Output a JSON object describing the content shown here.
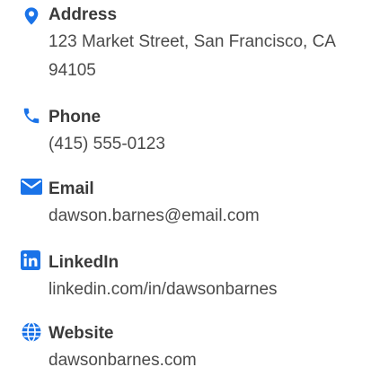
{
  "accent_color": "#1a73e8",
  "contact": {
    "items": [
      {
        "icon": "map-pin-icon",
        "label": "Address",
        "value": "123 Market Street, San Francisco, CA 94105"
      },
      {
        "icon": "phone-icon",
        "label": "Phone",
        "value": "(415) 555-0123"
      },
      {
        "icon": "envelope-icon",
        "label": "Email",
        "value": "dawson.barnes@email.com"
      },
      {
        "icon": "linkedin-icon",
        "label": "LinkedIn",
        "value": "linkedin.com/in/dawsonbarnes"
      },
      {
        "icon": "globe-icon",
        "label": "Website",
        "value": "dawsonbarnes.com"
      }
    ]
  }
}
